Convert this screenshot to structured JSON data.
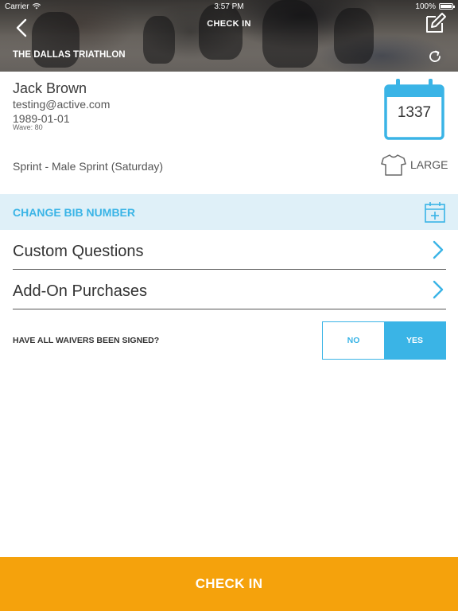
{
  "status_bar": {
    "carrier": "Carrier",
    "time": "3:57 PM",
    "battery": "100%"
  },
  "nav": {
    "title": "CHECK IN"
  },
  "event": {
    "title": "THE DALLAS TRIATHLON"
  },
  "participant": {
    "name": "Jack Brown",
    "email": "testing@active.com",
    "dob": "1989-01-01",
    "wave": "Wave: 80",
    "bib_number": "1337",
    "race": "Sprint - Male Sprint (Saturday)",
    "shirt_size": "LARGE"
  },
  "change_bib": {
    "label": "CHANGE BIB NUMBER"
  },
  "menu": [
    {
      "label": "Custom Questions"
    },
    {
      "label": "Add-On Purchases"
    }
  ],
  "waiver": {
    "question": "HAVE ALL WAIVERS BEEN SIGNED?",
    "no_label": "NO",
    "yes_label": "YES",
    "selected": "YES"
  },
  "footer": {
    "checkin_label": "CHECK IN"
  },
  "colors": {
    "accent": "#3ab4e6",
    "button": "#f5a20c",
    "bib_bar": "#dff0f8"
  }
}
